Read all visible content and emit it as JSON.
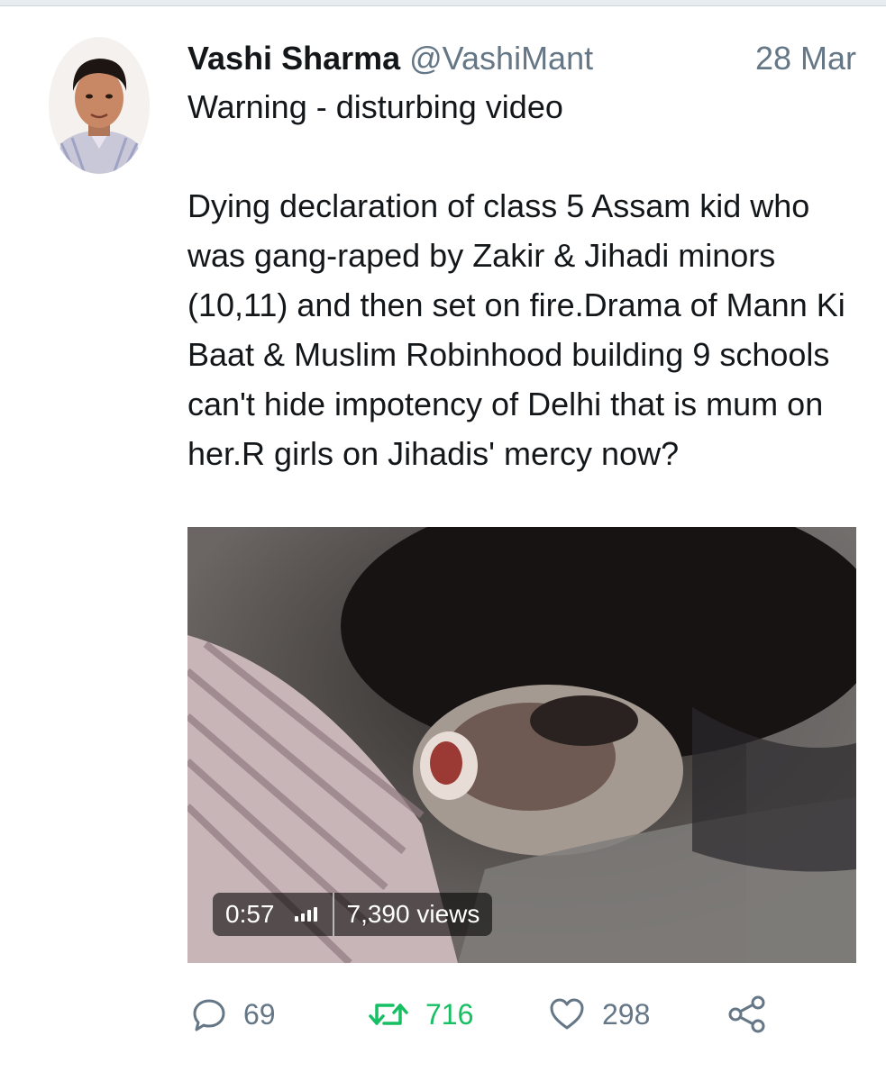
{
  "tweet": {
    "display_name": "Vashi Sharma",
    "handle": "@VashiMant",
    "timestamp": "28 Mar",
    "text_line_1": "Warning - disturbing video",
    "text_body": "Dying declaration of class 5 Assam kid who was gang-raped by Zakir & Jihadi minors (10,11) and then set on fire.Drama of Mann Ki Baat & Muslim Robinhood building 9 schools can't hide impotency of Delhi that is mum on her.R girls on Jihadis' mercy now?"
  },
  "media": {
    "duration": "0:57",
    "views": "7,390 views"
  },
  "actions": {
    "reply_count": "69",
    "retweet_count": "716",
    "like_count": "298"
  },
  "icons": {
    "reply": "reply-icon",
    "retweet": "retweet-icon",
    "like": "heart-icon",
    "share": "share-icon",
    "signal": "signal-bars-icon"
  },
  "colors": {
    "text": "#14171a",
    "secondary": "#657786",
    "retweet_active": "#17bf63"
  }
}
